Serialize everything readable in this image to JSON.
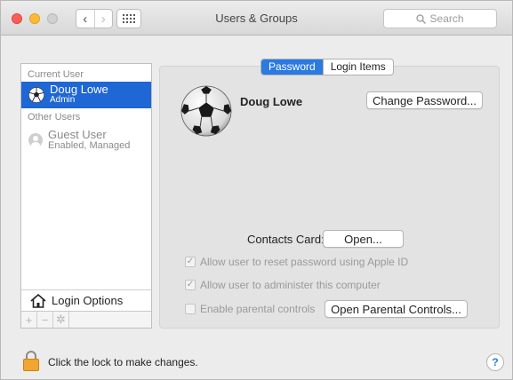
{
  "window": {
    "title": "Users & Groups"
  },
  "search": {
    "placeholder": "Search"
  },
  "sidebar": {
    "current_user_header": "Current User",
    "current_user": {
      "name": "Doug Lowe",
      "role": "Admin"
    },
    "other_users_header": "Other Users",
    "other_users": [
      {
        "name": "Guest User",
        "status": "Enabled, Managed"
      }
    ],
    "login_options_label": "Login Options",
    "tools": [
      "+",
      "−",
      "✲"
    ]
  },
  "tabs": [
    {
      "label": "Password",
      "active": true
    },
    {
      "label": "Login Items",
      "active": false
    }
  ],
  "profile": {
    "name": "Doug Lowe",
    "change_password_label": "Change Password...",
    "contacts_card_label": "Contacts Card:",
    "open_label": "Open..."
  },
  "options": {
    "reset_password": {
      "label": "Allow user to reset password using Apple ID",
      "checked": true
    },
    "administer": {
      "label": "Allow user to administer this computer",
      "checked": true
    },
    "parental": {
      "label": "Enable parental controls",
      "checked": false
    },
    "open_parental_label": "Open Parental Controls..."
  },
  "footer": {
    "lock_text": "Click the lock to make changes.",
    "help_label": "?"
  },
  "icons": {
    "lock": "lock-icon",
    "soccer_ball": "soccer-ball-avatar",
    "home": "home-icon"
  },
  "colors": {
    "selection": "#1f67d4",
    "tab_active": "#2a7ae2",
    "close": "#fc5f57",
    "minimize": "#fdbc2e",
    "lock": "#f0a630"
  }
}
